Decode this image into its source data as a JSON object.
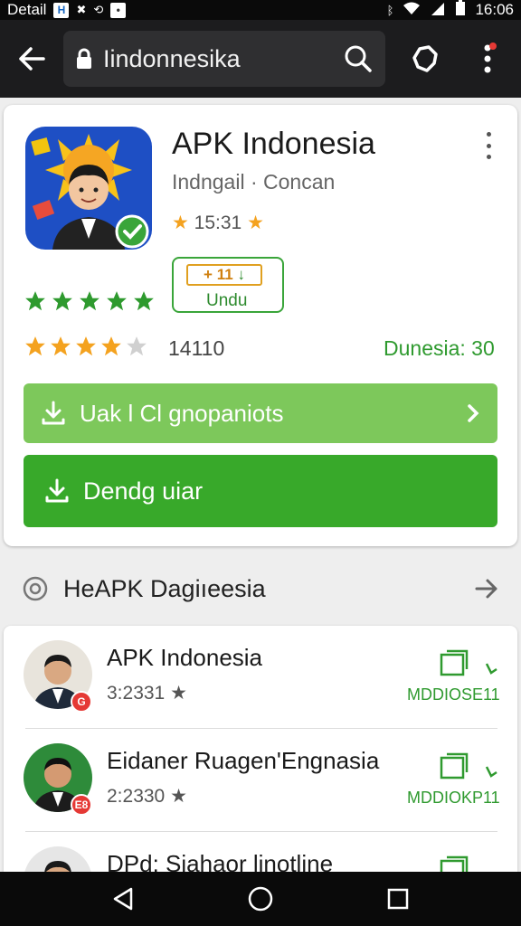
{
  "status_bar": {
    "label": "Detail",
    "time": "16:06"
  },
  "url_bar": {
    "url": "Iindonnesika"
  },
  "app": {
    "title": "APK Indonesia",
    "developer_line": "Indngail · Concan",
    "rating_text": "15:31",
    "badge_top": "11",
    "badge_bottom": "Undu",
    "rating_count": "14110",
    "download_info": "Dunesia: 30",
    "button_secondary": "Uak l Cl gnopaniots",
    "button_primary": "Dendg uiar",
    "green_stars": 5,
    "gold_stars": 4
  },
  "section": {
    "title": "HeAPK  Dagiıeesia"
  },
  "list": {
    "items": [
      {
        "name": "APK Indonesia",
        "rating": "3:2331",
        "action": "MDDIOSE11",
        "badge": "G"
      },
      {
        "name": "Eidaner Ruagen'Engnasia",
        "rating": "2:2330",
        "action": "MDDIOKP11",
        "badge": "E8"
      },
      {
        "name": "DPd: Siahaor linotline",
        "rating": "",
        "action": "",
        "badge": ""
      }
    ]
  },
  "colors": {
    "accent_green": "#38a92a",
    "light_green": "#7dc85b",
    "star_gold": "#f4a21f",
    "star_green": "#2e9a2e"
  }
}
